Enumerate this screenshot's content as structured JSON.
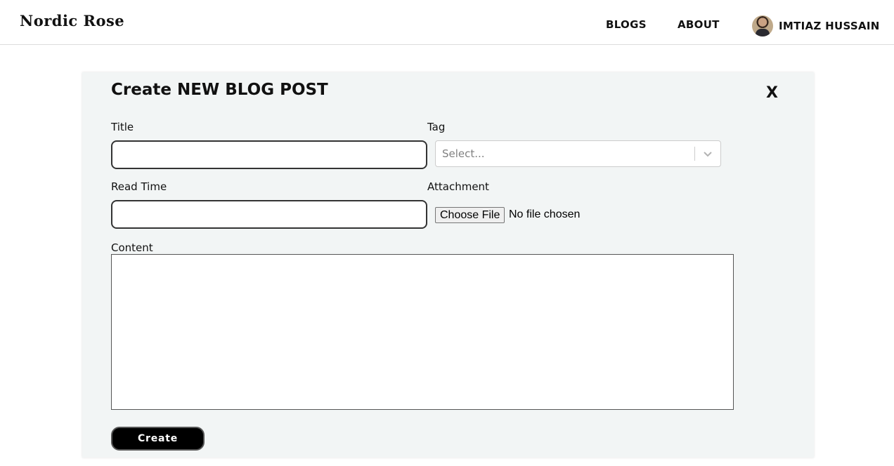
{
  "header": {
    "brand": "Nordic Rose",
    "nav": {
      "blogs": "BLOGS",
      "about": "ABOUT"
    },
    "user": {
      "name": "IMTIAZ HUSSAIN"
    }
  },
  "modal": {
    "title": "Create NEW BLOG POST",
    "close_label": "X",
    "fields": {
      "title": {
        "label": "Title",
        "value": ""
      },
      "tag": {
        "label": "Tag",
        "placeholder": "Select..."
      },
      "read_time": {
        "label": "Read Time",
        "value": ""
      },
      "attachment": {
        "label": "Attachment",
        "button": "Choose File",
        "status": "No file chosen"
      },
      "content": {
        "label": "Content",
        "value": ""
      }
    },
    "submit_label": "Create"
  },
  "colors": {
    "modal_bg": "#f2f5f5",
    "button_bg": "#000000",
    "button_text": "#ffffff"
  },
  "icons": {
    "select_indicator": "chevron-down-icon",
    "avatar": "user-avatar"
  }
}
